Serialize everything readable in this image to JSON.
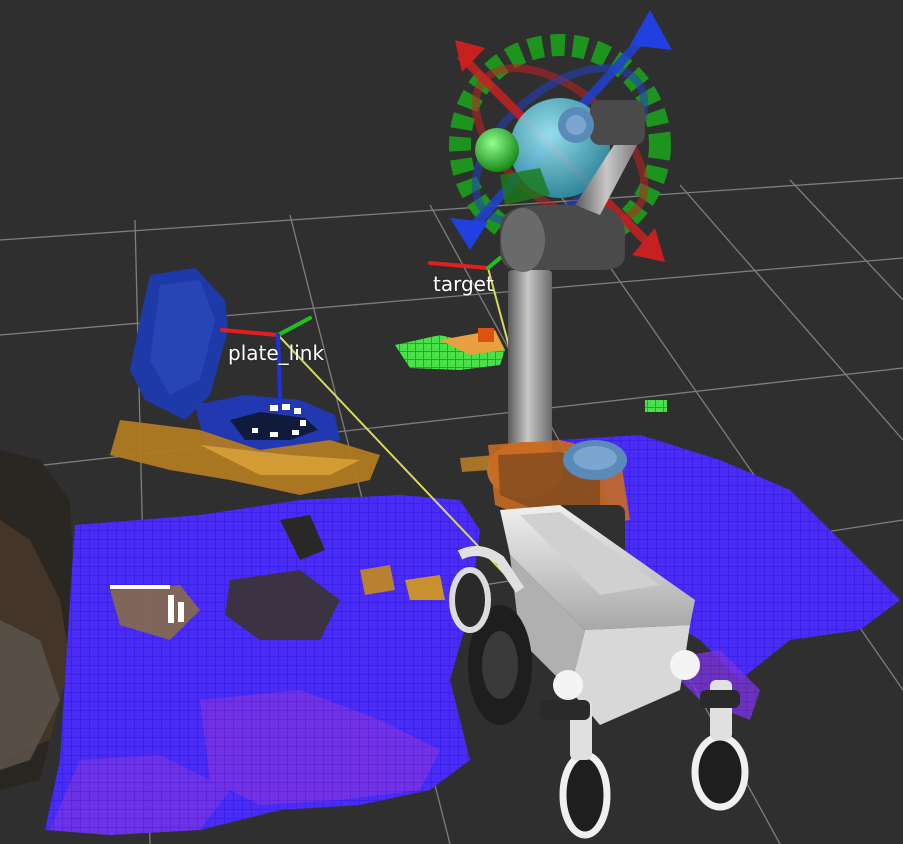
{
  "view": {
    "background_color": "#2f2f2f",
    "grid_color": "#a0a0a0"
  },
  "frames": {
    "plate_label": "plate_link",
    "target_label": "target"
  },
  "pointcloud": {
    "occupancy_colors": [
      "#2a1cf0",
      "#4a22e8",
      "#6a28e0",
      "#8a30d8"
    ],
    "floor_colors": [
      "#b07820",
      "#d09a30"
    ],
    "marker_colors": [
      "#3cd040",
      "#e05010"
    ]
  },
  "interactive_marker": {
    "ring_color": "#20b020",
    "axis_colors": {
      "x": "#d02020",
      "y": "#20c020",
      "z": "#2030d0"
    },
    "sphere_color": "#40c0d8"
  },
  "robot": {
    "arm_color": "#9a9a9a",
    "joint_color": "#505050",
    "cap_color": "#5a8ab8",
    "base_color": "#dcdcdc",
    "wheel_color": "#1e1e1e"
  },
  "link_line_color": "#d8d860"
}
